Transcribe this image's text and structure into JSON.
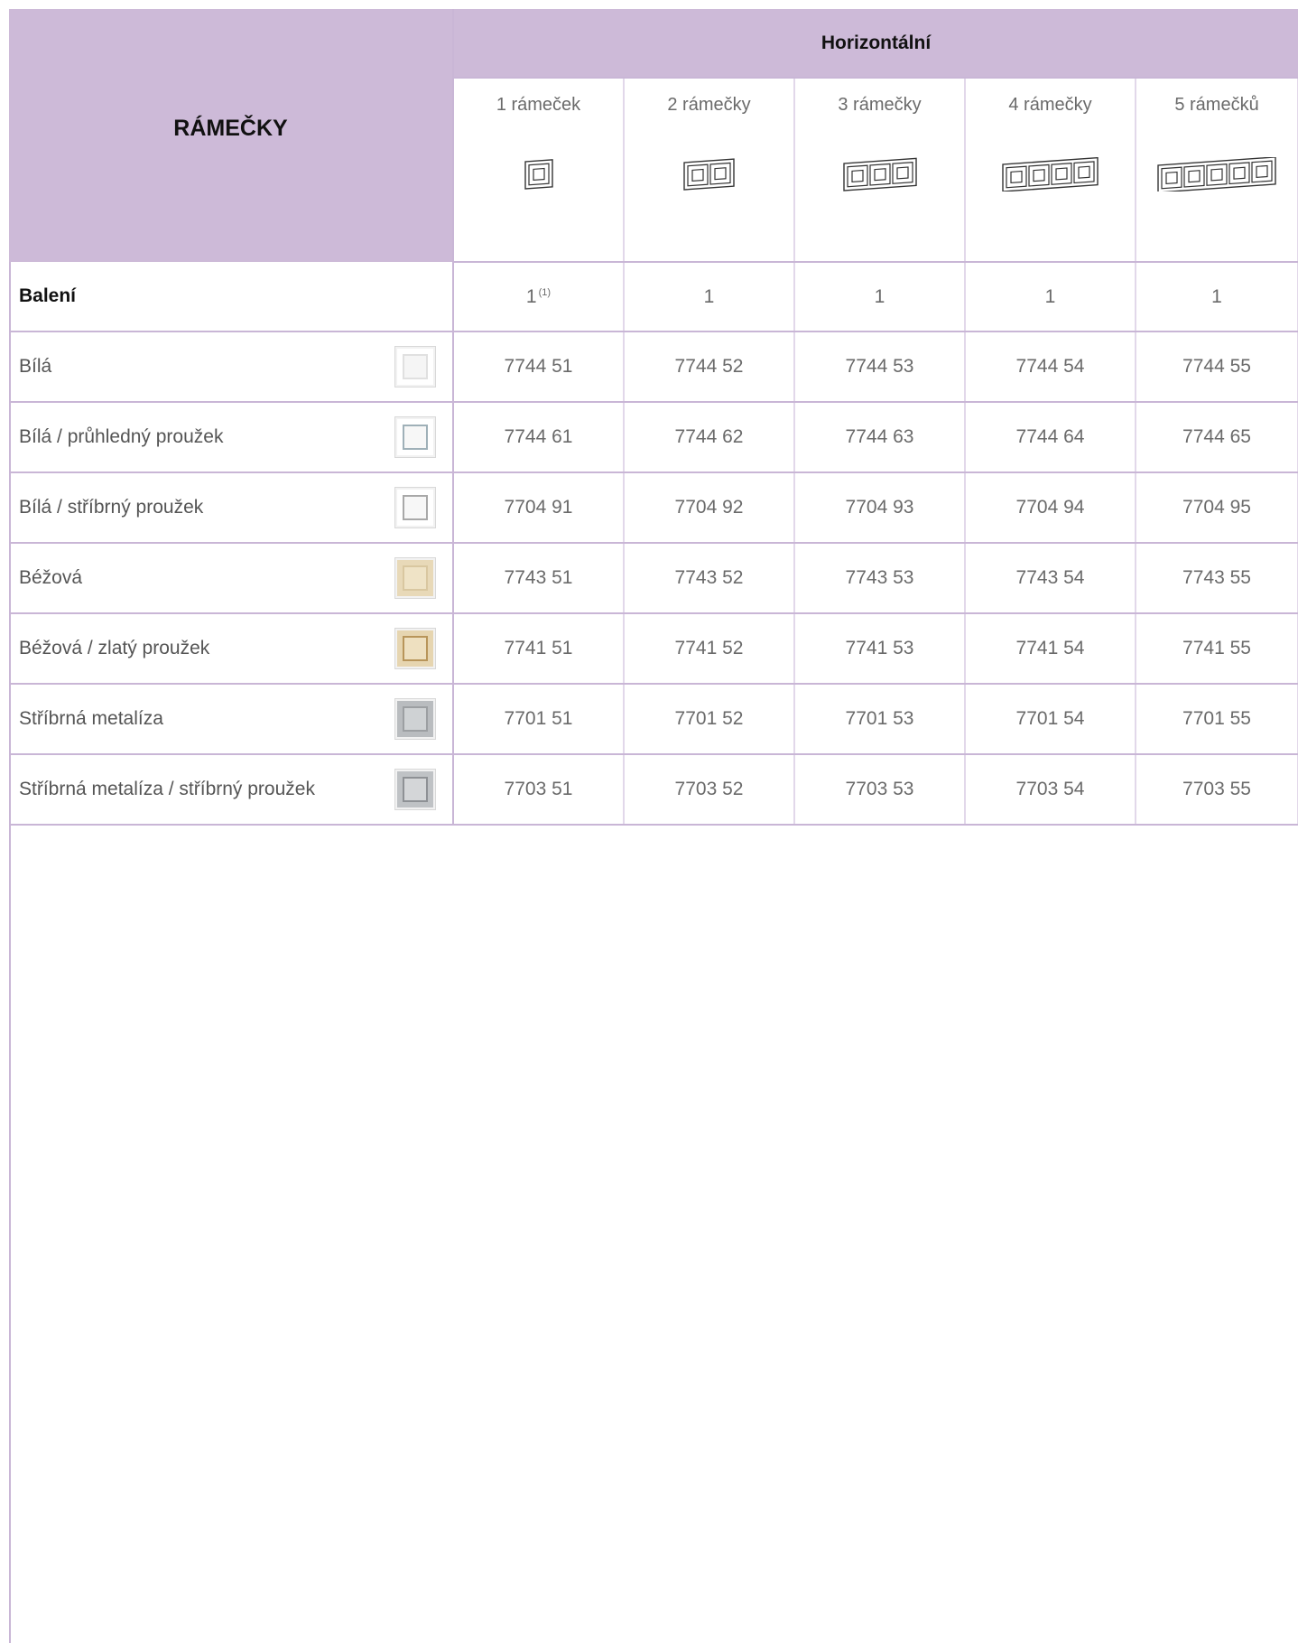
{
  "header": {
    "title": "RÁMEČKY",
    "group_label": "Horizontální",
    "columns": [
      "1 rámeček",
      "2 rámečky",
      "3 rámečky",
      "4 rámečky",
      "5 rámečků"
    ]
  },
  "packaging": {
    "label": "Balení",
    "values": [
      "1",
      "1",
      "1",
      "1",
      "1"
    ],
    "footnote_marker": "(1)"
  },
  "rows": [
    {
      "label": "Bílá",
      "swatch": {
        "outer": "#ffffff",
        "inner": "#f5f5f5",
        "border": "#e0e0e0"
      },
      "codes": [
        "7744 51",
        "7744 52",
        "7744 53",
        "7744 54",
        "7744 55"
      ]
    },
    {
      "label": "Bílá / průhledný proužek",
      "swatch": {
        "outer": "#ffffff",
        "inner": "#f7f7f7",
        "border": "#9fb0b8"
      },
      "codes": [
        "7744 61",
        "7744 62",
        "7744 63",
        "7744 64",
        "7744 65"
      ]
    },
    {
      "label": "Bílá / stříbrný proužek",
      "swatch": {
        "outer": "#ffffff",
        "inner": "#f7f7f7",
        "border": "#a8a8a8"
      },
      "codes": [
        "7704 91",
        "7704 92",
        "7704 93",
        "7704 94",
        "7704 95"
      ]
    },
    {
      "label": "Béžová",
      "swatch": {
        "outer": "#e8d9b8",
        "inner": "#efe3c6",
        "border": "#d9c7a0"
      },
      "codes": [
        "7743 51",
        "7743 52",
        "7743 53",
        "7743 54",
        "7743 55"
      ]
    },
    {
      "label": "Béžová / zlatý proužek",
      "swatch": {
        "outer": "#e6d5b0",
        "inner": "#eee0c0",
        "border": "#b8955a"
      },
      "codes": [
        "7741 51",
        "7741 52",
        "7741 53",
        "7741 54",
        "7741 55"
      ]
    },
    {
      "label": "Stříbrná metalíza",
      "swatch": {
        "outer": "#b9bcbf",
        "inner": "#cfd2d4",
        "border": "#9c9fa2"
      },
      "codes": [
        "7701 51",
        "7701 52",
        "7701 53",
        "7701 54",
        "7701 55"
      ]
    },
    {
      "label": "Stříbrná metalíza / stříbrný proužek",
      "swatch": {
        "outer": "#bfc2c5",
        "inner": "#d4d6d8",
        "border": "#8e9195"
      },
      "codes": [
        "7703 51",
        "7703 52",
        "7703 53",
        "7703 54",
        "7703 55"
      ]
    }
  ],
  "colors": {
    "header_bg": "#cdbad8",
    "grid_line": "#c9b6d6"
  },
  "icons": [
    "frame-1-gang-icon",
    "frame-2-gang-icon",
    "frame-3-gang-icon",
    "frame-4-gang-icon",
    "frame-5-gang-icon"
  ]
}
